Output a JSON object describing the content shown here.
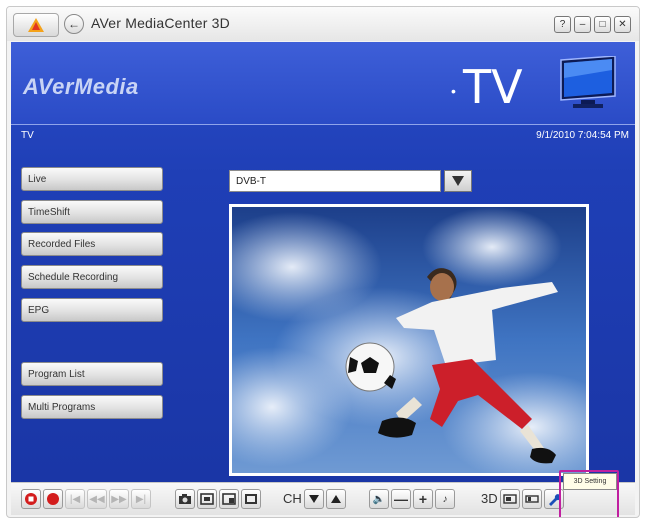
{
  "window": {
    "title": "AVer MediaCenter 3D"
  },
  "header": {
    "brand": "AVerMedia",
    "section_title": "TV",
    "breadcrumb": "TV",
    "datetime": "9/1/2010 7:04:54 PM"
  },
  "sidebar": {
    "items": [
      {
        "label": "Live"
      },
      {
        "label": "TimeShift"
      },
      {
        "label": "Recorded Files"
      },
      {
        "label": "Schedule Recording"
      },
      {
        "label": "EPG"
      },
      {
        "label": "Program List"
      },
      {
        "label": "Multi Programs"
      }
    ]
  },
  "source": {
    "selected": "DVB-T"
  },
  "controls": {
    "ch_label": "CH",
    "three_d_label": "3D",
    "tooltip": "3D Setting"
  },
  "colors": {
    "accent_blue": "#2a4cc8",
    "record_red": "#d31c1c",
    "highlight": "#c01fa0"
  }
}
